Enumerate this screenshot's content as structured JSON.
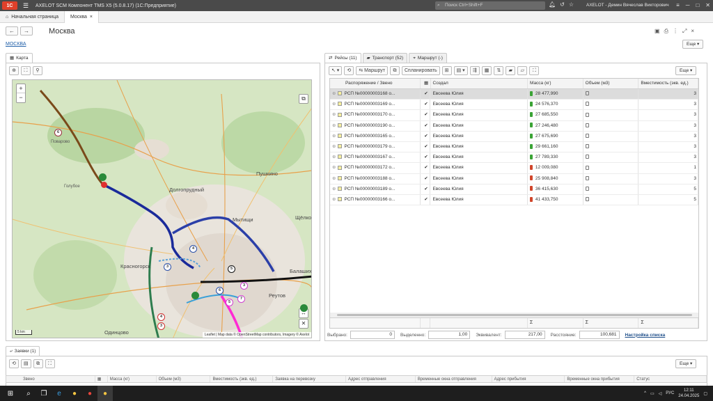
{
  "titlebar": {
    "logo": "1C",
    "title": "AXELOT SCM   Компонент TMS X5 (5.0.8.17)   (1С:Предприятие)",
    "search_placeholder": "Поиск Ctrl+Shift+F",
    "user": "AXELOT - Демин Вячеслав Викторович"
  },
  "page_tabs": [
    {
      "label": "Начальная страница"
    },
    {
      "label": "Москва"
    }
  ],
  "page": {
    "title": "Москва",
    "link": "МОСКВА",
    "more_label": "Еще ▾"
  },
  "left_panel": {
    "tab_label": "Карта"
  },
  "map": {
    "labels": [
      {
        "text": "Поварово"
      },
      {
        "text": "Пушкино"
      },
      {
        "text": "Долгопрудный"
      },
      {
        "text": "Мытищи"
      },
      {
        "text": "Красногорск"
      },
      {
        "text": "Реутов"
      },
      {
        "text": "Одинцово"
      },
      {
        "text": "Балашиха"
      },
      {
        "text": "Щёлково"
      },
      {
        "text": "Голубое"
      }
    ],
    "pins": [
      "6",
      "4",
      "3",
      "6",
      "5",
      "3",
      "4",
      "3",
      "7",
      "5"
    ],
    "scale": "5 km",
    "attribution": "Leaflet | Map data © OpenStreetMap contributors, Imagery © Axelot"
  },
  "right_tabs": [
    {
      "label": "Рейсы (11)"
    },
    {
      "label": "Транспорт (52)"
    },
    {
      "label": "Маршрут (-)"
    }
  ],
  "toolbar": {
    "route_label": "Маршрут",
    "plan_label": "Спланировать",
    "more_label": "Еще ▾"
  },
  "grid": {
    "headers": [
      "Распоряжение / Звено",
      "",
      "Создал",
      "Масса (кг)",
      "Объем (м3)",
      "Вместимость (экв. ед.)"
    ],
    "rows": [
      {
        "order": "РСП №00000003168 о...",
        "creator": "Евсеева Юлия",
        "mass": "28 477,990",
        "color": "#3aa335",
        "cap": "3"
      },
      {
        "order": "РСП №00000003169 о...",
        "creator": "Евсеева Юлия",
        "mass": "24 576,370",
        "color": "#3aa335",
        "cap": "3"
      },
      {
        "order": "РСП №00000003170 о...",
        "creator": "Евсеева Юлия",
        "mass": "27 685,550",
        "color": "#3aa335",
        "cap": "3"
      },
      {
        "order": "РСП №00000003190 о...",
        "creator": "Евсеева Юлия",
        "mass": "27 246,480",
        "color": "#3aa335",
        "cap": "3"
      },
      {
        "order": "РСП №00000003165 о...",
        "creator": "Евсеева Юлия",
        "mass": "27 675,690",
        "color": "#3aa335",
        "cap": "3"
      },
      {
        "order": "РСП №00000003179 о...",
        "creator": "Евсеева Юлия",
        "mass": "29 661,160",
        "color": "#3aa335",
        "cap": "3"
      },
      {
        "order": "РСП №00000003167 о...",
        "creator": "Евсеева Юлия",
        "mass": "27 789,330",
        "color": "#3aa335",
        "cap": "3"
      },
      {
        "order": "РСП №00000003172 о...",
        "creator": "Евсеева Юлия",
        "mass": "12 009,080",
        "color": "#d0452a",
        "cap": "1"
      },
      {
        "order": "РСП №00000003188 о...",
        "creator": "Евсеева Юлия",
        "mass": "25 908,840",
        "color": "#d0452a",
        "cap": "3"
      },
      {
        "order": "РСП №00000003189 о...",
        "creator": "Евсеева Юлия",
        "mass": "36 415,630",
        "color": "#d0452a",
        "cap": "5"
      },
      {
        "order": "РСП №00000003166 о...",
        "creator": "Евсеева Юлия",
        "mass": "41 433,750",
        "color": "#d0452a",
        "cap": "5"
      }
    ],
    "footer_sum": "Σ"
  },
  "summary": {
    "selected_label": "Выбрано:",
    "selected_value": "0",
    "marked_label": "Выделенно:",
    "marked_value": "1,00",
    "equiv_label": "Эквивалент:",
    "equiv_value": "217,00",
    "distance_label": "Расстояние:",
    "distance_value": "100,681",
    "settings_link": "Настройка списка"
  },
  "bottom": {
    "tab_label": "Заявки (1)",
    "more_label": "Еще ▾",
    "headers": [
      "Звено",
      "Масса (кг)",
      "Объем (м3)",
      "Вместимость (экв. ед.)",
      "Заявка на перевозку",
      "Адрес отправления",
      "Временные окна отправления",
      "Адрес прибытия",
      "Временные окна прибытия",
      "Статус"
    ]
  },
  "taskbar": {
    "lang": "РУС",
    "time": "12:11",
    "date": "24.04.2025"
  }
}
